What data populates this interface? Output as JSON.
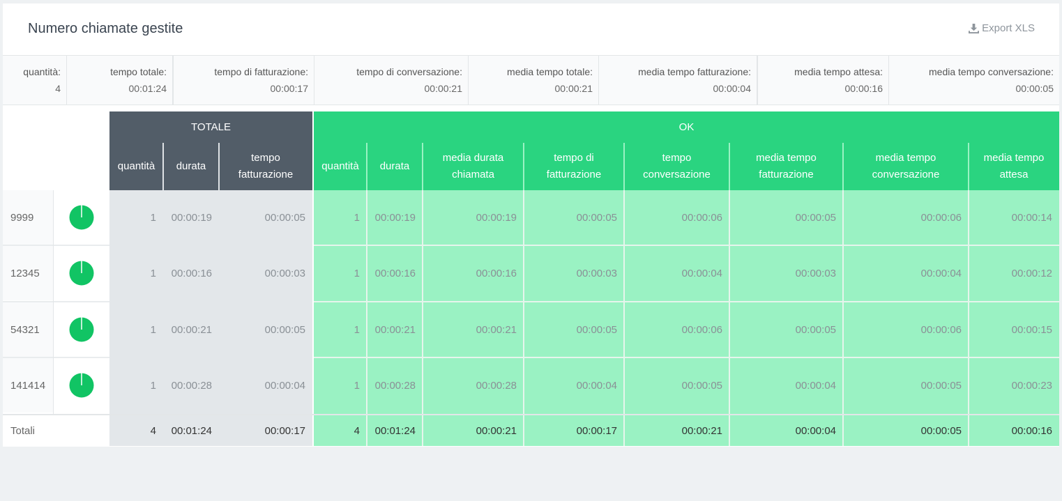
{
  "header": {
    "title": "Numero chiamate gestite",
    "export_label": "Export XLS"
  },
  "stats": [
    {
      "label": "quantità:",
      "value": "4"
    },
    {
      "label": "tempo totale:",
      "value": "00:01:24"
    },
    {
      "label": "tempo di fatturazione:",
      "value": "00:00:17"
    },
    {
      "label": "tempo di conversazione:",
      "value": "00:00:21"
    },
    {
      "label": "media tempo totale:",
      "value": "00:00:21"
    },
    {
      "label": "media tempo fatturazione:",
      "value": "00:00:04"
    },
    {
      "label": "media tempo attesa:",
      "value": "00:00:16"
    },
    {
      "label": "media tempo conversazione:",
      "value": "00:00:05"
    }
  ],
  "table": {
    "group_totale": "TOTALE",
    "group_ok": "OK",
    "columns_totale": [
      "quantità",
      "durata",
      "tempo\nfatturazione"
    ],
    "columns_ok": [
      "quantità",
      "durata",
      "media durata\nchiamata",
      "tempo di\nfatturazione",
      "tempo\nconversazione",
      "media tempo\nfatturazione",
      "media tempo\nconversazione",
      "media tempo\nattesa"
    ],
    "rows": [
      {
        "id": "9999",
        "totale": [
          "1",
          "00:00:19",
          "00:00:05"
        ],
        "ok": [
          "1",
          "00:00:19",
          "00:00:19",
          "00:00:05",
          "00:00:06",
          "00:00:05",
          "00:00:06",
          "00:00:14"
        ]
      },
      {
        "id": "12345",
        "totale": [
          "1",
          "00:00:16",
          "00:00:03"
        ],
        "ok": [
          "1",
          "00:00:16",
          "00:00:16",
          "00:00:03",
          "00:00:04",
          "00:00:03",
          "00:00:04",
          "00:00:12"
        ]
      },
      {
        "id": "54321",
        "totale": [
          "1",
          "00:00:21",
          "00:00:05"
        ],
        "ok": [
          "1",
          "00:00:21",
          "00:00:21",
          "00:00:05",
          "00:00:06",
          "00:00:05",
          "00:00:06",
          "00:00:15"
        ]
      },
      {
        "id": "141414",
        "totale": [
          "1",
          "00:00:28",
          "00:00:04"
        ],
        "ok": [
          "1",
          "00:00:28",
          "00:00:28",
          "00:00:04",
          "00:00:05",
          "00:00:04",
          "00:00:05",
          "00:00:23"
        ]
      }
    ],
    "totals": {
      "label": "Totali",
      "totale": [
        "4",
        "00:01:24",
        "00:00:17"
      ],
      "ok": [
        "4",
        "00:01:24",
        "00:00:21",
        "00:00:17",
        "00:00:21",
        "00:00:04",
        "00:00:05",
        "00:00:16"
      ]
    }
  },
  "colors": {
    "green": "#2ad480",
    "light_green": "#9af2c3",
    "dark_header": "#525d68",
    "pie": "#11c464"
  },
  "pie_icon": "pie-chart-icon"
}
